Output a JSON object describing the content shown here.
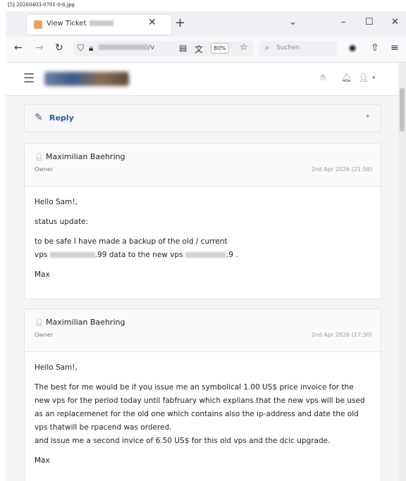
{
  "caption": "[5] 20260403-0701-0-6.jpg",
  "browser": {
    "tab": {
      "title": "View Ticket"
    },
    "zoom": "80%",
    "search_placeholder": "Suchen",
    "url_suffix": "/v"
  },
  "reply": {
    "label": "Reply"
  },
  "messages": [
    {
      "author": "Maximilian Baehring",
      "role": "Owner",
      "timestamp": "2nd Apr 2026 (21:58)",
      "greeting": "Hello Sam!,",
      "line1": "status update:",
      "line2": "to be safe I have made a backup of the old / current",
      "line3a": "vps ",
      "line3b": ".99 data to the new vps ",
      "line3c": ".9 .",
      "sign": "Max"
    },
    {
      "author": "Maximilian Baehring",
      "role": "Owner",
      "timestamp": "2nd Apr 2026 (17:30)",
      "greeting": "Hello Sam!,",
      "para": "The best for me would be if you issue me an symbolical 1.00 US$ price invoice for the new vps for the period today until fabfruary which explians that the new vps will be used as an replacemenet for the old one which contains also the ip-address and date the old vps thatwill be rpacend was ordered.",
      "para2": "and issue me a second invice of 6.50 US$ for this old vps and the dcic upgrade.",
      "sign": "Max"
    }
  ]
}
